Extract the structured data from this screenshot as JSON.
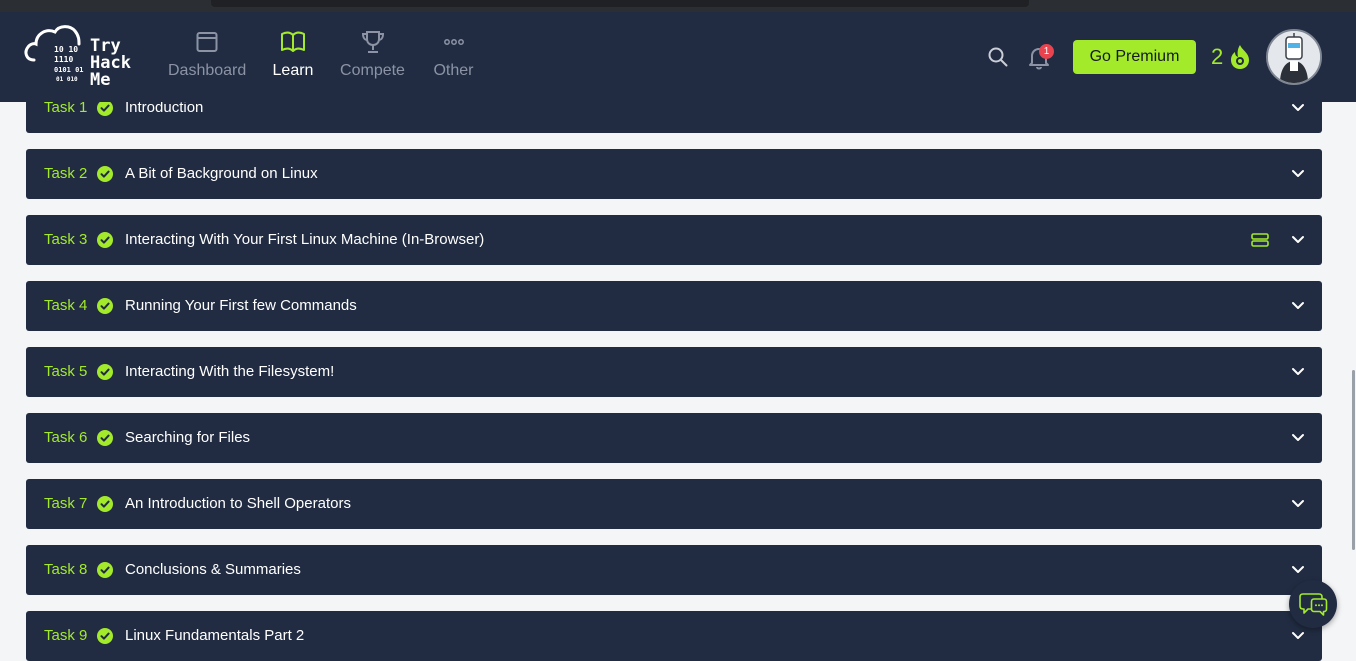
{
  "logo": {
    "lines": [
      "Try",
      "Hack",
      "Me"
    ],
    "binary": [
      "10 10",
      "1110",
      "0101 01",
      "01 010"
    ]
  },
  "nav": {
    "items": [
      {
        "label": "Dashboard",
        "icon": "window-icon",
        "active": false
      },
      {
        "label": "Learn",
        "icon": "book-icon",
        "active": true
      },
      {
        "label": "Compete",
        "icon": "trophy-icon",
        "active": false
      },
      {
        "label": "Other",
        "icon": "dots-icon",
        "active": false
      }
    ],
    "notification_count": "1",
    "premium_label": "Go Premium",
    "streak": "2"
  },
  "tasks": [
    {
      "num": "Task 1",
      "title": "Introduction",
      "completed": true
    },
    {
      "num": "Task 2",
      "title": "A Bit of Background on Linux",
      "completed": true
    },
    {
      "num": "Task 3",
      "title": "Interacting With Your First Linux Machine (In-Browser)",
      "completed": true,
      "has_machine": true
    },
    {
      "num": "Task 4",
      "title": "Running Your First few Commands",
      "completed": true
    },
    {
      "num": "Task 5",
      "title": "Interacting With the Filesystem!",
      "completed": true
    },
    {
      "num": "Task 6",
      "title": "Searching for Files",
      "completed": true
    },
    {
      "num": "Task 7",
      "title": "An Introduction to Shell Operators",
      "completed": true
    },
    {
      "num": "Task 8",
      "title": "Conclusions & Summaries",
      "completed": true
    },
    {
      "num": "Task 9",
      "title": "Linux Fundamentals Part 2",
      "completed": true
    }
  ],
  "colors": {
    "accent": "#a3ea2a",
    "panel": "#212c42",
    "background": "#f4f5f7",
    "badge": "#e8434f"
  }
}
